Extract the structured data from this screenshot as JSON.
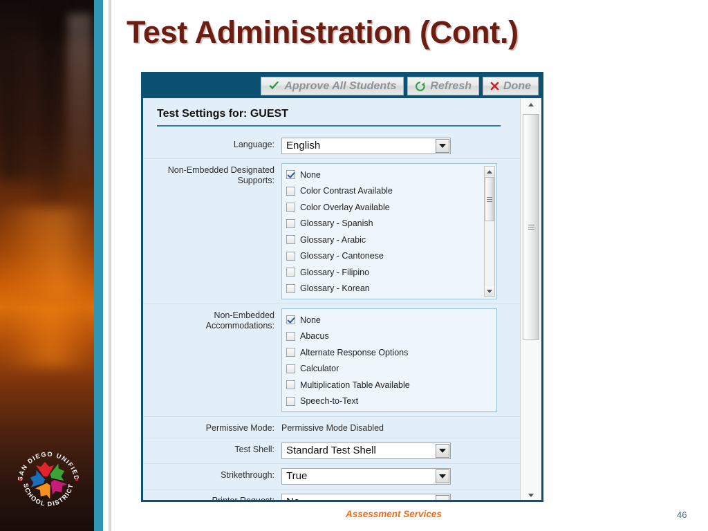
{
  "slide": {
    "title": "Test Administration (Cont.)",
    "title_color": "#6b1d12",
    "footer_brand": "Assessment Services",
    "footer_brand_color": "#ef6c17",
    "page_number": "46"
  },
  "logo": {
    "top_arc_text": "SAN DIEGO UNIFIED",
    "bottom_arc_text": "SCHOOL DISTRICT",
    "petal_colors": [
      "#e0242c",
      "#3aa536",
      "#1b6fb8",
      "#c71b7a",
      "#f6921e"
    ]
  },
  "app": {
    "toolbar": {
      "background": "#0d5172",
      "buttons": [
        {
          "label": "Approve All Students",
          "icon": "check-icon",
          "icon_color": "#1f9d3f"
        },
        {
          "label": "Refresh",
          "icon": "refresh-icon",
          "icon_color": "#2f9e44"
        },
        {
          "label": "Done",
          "icon": "close-x-icon",
          "icon_color": "#c0272d"
        }
      ]
    },
    "heading": "Test Settings for: GUEST",
    "rows": {
      "language": {
        "label": "Language:",
        "value": "English",
        "type": "select"
      },
      "designated_supports": {
        "label_line1": "Non-Embedded Designated",
        "label_line2": "Supports:",
        "type": "checkbox-list",
        "scrollable": true,
        "options": [
          {
            "label": "None",
            "checked": true
          },
          {
            "label": "Color Contrast Available",
            "checked": false
          },
          {
            "label": "Color Overlay Available",
            "checked": false
          },
          {
            "label": "Glossary - Spanish",
            "checked": false
          },
          {
            "label": "Glossary - Arabic",
            "checked": false
          },
          {
            "label": "Glossary - Cantonese",
            "checked": false
          },
          {
            "label": "Glossary - Filipino",
            "checked": false
          },
          {
            "label": "Glossary - Korean",
            "checked": false
          }
        ]
      },
      "accommodations": {
        "label_line1": "Non-Embedded",
        "label_line2": "Accommodations:",
        "type": "checkbox-list",
        "scrollable": false,
        "options": [
          {
            "label": "None",
            "checked": true
          },
          {
            "label": "Abacus",
            "checked": false
          },
          {
            "label": "Alternate Response Options",
            "checked": false
          },
          {
            "label": "Calculator",
            "checked": false
          },
          {
            "label": "Multiplication Table Available",
            "checked": false
          },
          {
            "label": "Speech-to-Text",
            "checked": false
          }
        ]
      },
      "permissive_mode": {
        "label": "Permissive Mode:",
        "value": "Permissive Mode Disabled",
        "type": "text"
      },
      "test_shell": {
        "label": "Test Shell:",
        "value": "Standard Test Shell",
        "type": "select"
      },
      "strikethrough": {
        "label": "Strikethrough:",
        "value": "True",
        "type": "select"
      },
      "printer_request": {
        "label": "Printer Request:",
        "value": "No",
        "type": "select"
      }
    }
  }
}
